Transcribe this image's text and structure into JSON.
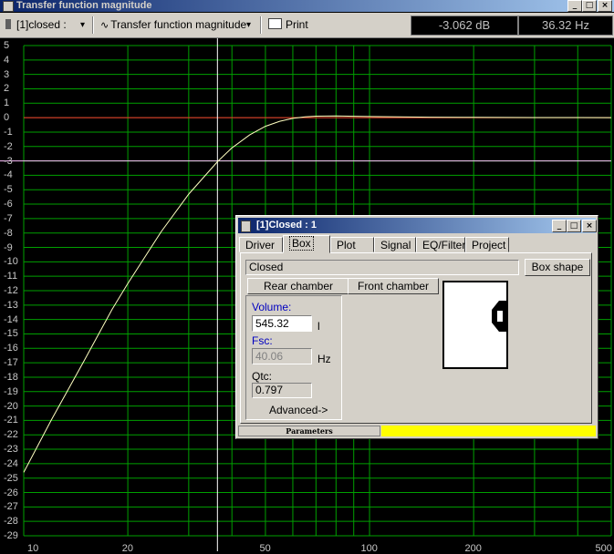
{
  "window": {
    "title": "Transfer function magnitude",
    "buttons": [
      "_",
      "□",
      "×"
    ]
  },
  "toolbar": {
    "dropdown1": "[1]closed :",
    "dropdown2": "Transfer function magnitude",
    "print_label": "Print",
    "readout_db": "-3.062 dB",
    "readout_hz": "36.32 Hz",
    "arrow": "▾"
  },
  "chart_data": {
    "type": "line",
    "x_scale": "log",
    "xlim": [
      10,
      500
    ],
    "ylim": [
      -29,
      5
    ],
    "x_ticks": [
      "10",
      "20",
      "50",
      "100",
      "200",
      "500"
    ],
    "y_ticks": [
      "5",
      "4",
      "3",
      "2",
      "1",
      "0",
      "-1",
      "-2",
      "-3",
      "-4",
      "-5",
      "-6",
      "-7",
      "-8",
      "-9",
      "-10",
      "-11",
      "-12",
      "-13",
      "-14",
      "-15",
      "-16",
      "-17",
      "-18",
      "-19",
      "-20",
      "-21",
      "-22",
      "-23",
      "-24",
      "-25",
      "-26",
      "-27",
      "-28",
      "-29"
    ],
    "series": [
      {
        "x": [
          10,
          12,
          15,
          18,
          20,
          25,
          30,
          36.32,
          40,
          45,
          50,
          55,
          60,
          65,
          70,
          80,
          100,
          150,
          200,
          300,
          500
        ],
        "y": [
          -24.6,
          -21.0,
          -16.8,
          -13.3,
          -11.5,
          -7.9,
          -5.3,
          -3.06,
          -2.1,
          -1.2,
          -0.6,
          -0.25,
          -0.05,
          0.05,
          0.1,
          0.12,
          0.08,
          0.03,
          0.02,
          0.01,
          0.0
        ],
        "color": "#ffffc0"
      }
    ],
    "reference_lines": {
      "zero_db_color": "#ff3030",
      "minus3_color": "#ffc0ff",
      "cursor_x": 36.32
    },
    "grid": true,
    "grid_color": "#00a000"
  },
  "dialog": {
    "title": "[1]Closed : 1",
    "buttons": [
      "_",
      "□",
      "×"
    ],
    "tabs": [
      "Driver",
      "Box",
      "Plot",
      "Signal",
      "EQ/Filter",
      "Project"
    ],
    "active_tab": "Box",
    "box_type": "Closed",
    "box_shape_button": "Box shape",
    "rear_chamber_button": "Rear chamber",
    "front_chamber_button": "Front chamber",
    "volume_label": "Volume:",
    "volume_value": "545.32",
    "volume_unit": "l",
    "fsc_label": "Fsc:",
    "fsc_value": "40.06",
    "fsc_unit": "Hz",
    "qtc_label": "Qtc:",
    "qtc_value": "0.797",
    "advanced_button": "Advanced->",
    "status_left": "Parameters",
    "status_right_color": "#ffff00"
  }
}
